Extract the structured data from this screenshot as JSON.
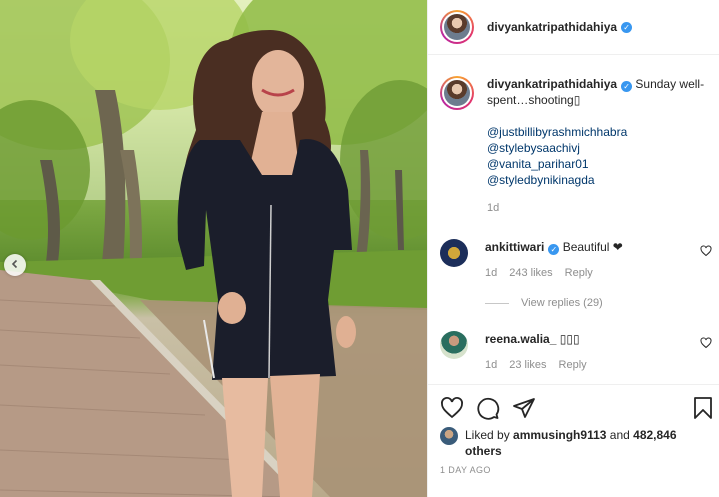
{
  "post": {
    "username": "divyankatripathidahiya",
    "caption": "Sunday well-spent…shooting",
    "caption_emoji": "▯",
    "mentions": [
      "@justbillibyrashmichhabra",
      "@stylebysaachivj",
      "@vanita_parihar01",
      "@styledbynikinagda"
    ],
    "caption_time": "1d"
  },
  "comments": [
    {
      "username": "ankittiwari",
      "verified": true,
      "text": "Beautiful ❤",
      "time": "1d",
      "likes": "243 likes",
      "reply": "Reply"
    },
    {
      "username": "reena.walia_",
      "verified": false,
      "text": "▯▯▯",
      "time": "1d",
      "likes": "23 likes",
      "reply": "Reply"
    }
  ],
  "view_replies": "View replies (29)",
  "liked_by": {
    "prefix": "Liked by",
    "user": "ammusingh9113",
    "and": "and",
    "count": "482,846 others"
  },
  "posted_ago": "1 DAY AGO",
  "icons": {
    "verified": "verified-badge-icon",
    "heart": "heart-icon",
    "comment": "comment-icon",
    "share": "share-icon",
    "save": "bookmark-icon",
    "prev": "chevron-left-icon"
  },
  "colors": {
    "link": "#00376b",
    "verified": "#3897f0",
    "muted": "#8e8e8e"
  }
}
